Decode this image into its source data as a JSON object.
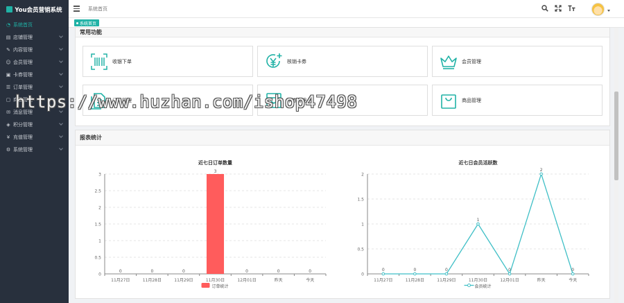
{
  "app": {
    "title": "You会员营销系统"
  },
  "sidebar": {
    "items": [
      {
        "label": "系统首页",
        "icon": "dashboard-icon",
        "active": true,
        "chevron": false
      },
      {
        "label": "店铺管理",
        "icon": "shop-icon",
        "chevron": true
      },
      {
        "label": "内容管理",
        "icon": "edit-icon",
        "chevron": true
      },
      {
        "label": "会员管理",
        "icon": "user-icon",
        "chevron": true
      },
      {
        "label": "卡券管理",
        "icon": "card-icon",
        "chevron": true
      },
      {
        "label": "订单管理",
        "icon": "list-icon",
        "chevron": true
      },
      {
        "label": "商品管理",
        "icon": "goods-icon",
        "chevron": true
      },
      {
        "label": "消息管理",
        "icon": "message-icon",
        "chevron": true
      },
      {
        "label": "积分管理",
        "icon": "points-icon",
        "chevron": true
      },
      {
        "label": "充值管理",
        "icon": "recharge-icon",
        "chevron": true
      },
      {
        "label": "系统管理",
        "icon": "gear-icon",
        "chevron": true
      }
    ]
  },
  "header": {
    "breadcrumb": "系统首页"
  },
  "tabs": [
    {
      "label": "系统首页",
      "active": true
    }
  ],
  "quick": {
    "title": "常用功能",
    "items": [
      {
        "label": "收银下单",
        "icon": "scan-icon"
      },
      {
        "label": "核销卡券",
        "icon": "yuan-icon"
      },
      {
        "label": "会员管理",
        "icon": "crown-icon"
      },
      {
        "label": "订单管理",
        "icon": "document-icon"
      },
      {
        "label": "卡券管理",
        "icon": "ticket-icon"
      },
      {
        "label": "商品管理",
        "icon": "bag-icon"
      }
    ]
  },
  "stats": {
    "title": "报表统计"
  },
  "watermark": "https://www.huzhan.com/ishop47498",
  "colors": {
    "accent": "#20b2a6",
    "bar": "#ff5c5c",
    "line": "#3fbfc6",
    "sidebar": "#28303d"
  },
  "chart_data": [
    {
      "type": "bar",
      "title": "近七日订单数量",
      "categories": [
        "11月27日",
        "11月28日",
        "11月29日",
        "11月30日",
        "12月01日",
        "昨天",
        "今天"
      ],
      "series": [
        {
          "name": "订单统计",
          "values": [
            0,
            0,
            0,
            3,
            0,
            0,
            0
          ]
        }
      ],
      "ylim": [
        0,
        3
      ],
      "yticks": [
        "0",
        "0.5",
        "1",
        "1.5",
        "2",
        "2.5",
        "3"
      ],
      "legend": "bottom"
    },
    {
      "type": "line",
      "title": "近七日会员活跃数",
      "categories": [
        "11月27日",
        "11月28日",
        "11月29日",
        "11月30日",
        "12月01日",
        "昨天",
        "今天"
      ],
      "series": [
        {
          "name": "会员统计",
          "values": [
            0,
            0,
            0,
            1,
            0,
            2,
            0
          ]
        }
      ],
      "ylim": [
        0,
        2
      ],
      "yticks": [
        "0",
        "0.5",
        "1",
        "1.5",
        "2"
      ],
      "legend": "bottom"
    }
  ]
}
